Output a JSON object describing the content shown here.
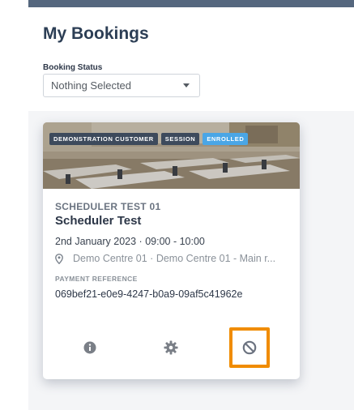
{
  "header": {
    "title": "My Bookings",
    "filter_label": "Booking Status",
    "filter_value": "Nothing Selected"
  },
  "booking": {
    "badges": [
      "DEMONSTRATION CUSTOMER",
      "SESSION",
      "ENROLLED"
    ],
    "course_code": "SCHEDULER TEST 01",
    "course_name": "Scheduler Test",
    "session_time": "2nd January 2023 · 09:00 - 10:00",
    "location": "Demo Centre 01 · Demo Centre 01 - Main r...",
    "payment_label": "PAYMENT REFERENCE",
    "payment_reference": "069bef21-e0e9-4247-b0a9-09af5c41962e"
  },
  "actions": [
    {
      "icon": "info-icon"
    },
    {
      "icon": "gear-icon"
    },
    {
      "icon": "cancel-icon",
      "highlighted": true
    }
  ],
  "colors": {
    "topbar": "#55677e",
    "title": "#2c3e55",
    "badge_dark": "#3d4a5c",
    "badge_enrolled": "#4aa6e6",
    "highlight": "#f08c00"
  }
}
